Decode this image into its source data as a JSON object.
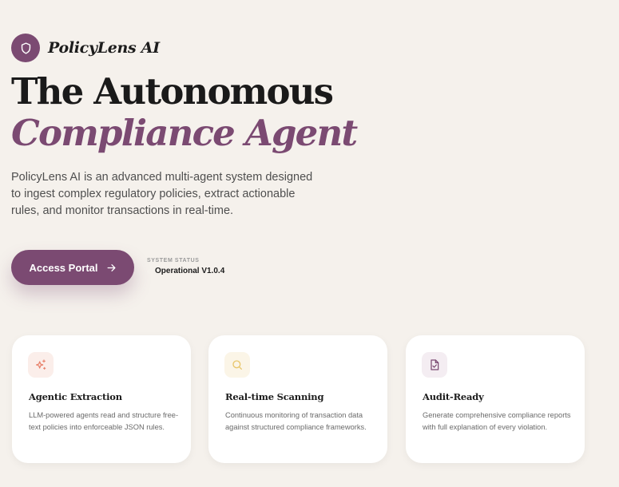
{
  "brand": {
    "name": "PolicyLens AI",
    "icon": "shield-icon",
    "color": "#7b4a72"
  },
  "hero": {
    "title_line1": "The Autonomous",
    "title_line2": "Compliance Agent",
    "description": "PolicyLens AI is an advanced multi-agent system designed to ingest complex regulatory policies, extract actionable rules, and monitor transactions in real-time."
  },
  "cta": {
    "label": "Access Portal",
    "icon": "arrow-right-icon"
  },
  "status": {
    "label": "SYSTEM STATUS",
    "value": "Operational V1.0.4"
  },
  "features": [
    {
      "icon": "sparkles-icon",
      "icon_color": "#e8826b",
      "title": "Agentic Extraction",
      "description": "LLM-powered agents read and structure free-text policies into enforceable JSON rules."
    },
    {
      "icon": "search-icon",
      "icon_color": "#e8c66b",
      "title": "Real-time Scanning",
      "description": "Continuous monitoring of transaction data against structured compliance frameworks."
    },
    {
      "icon": "file-check-icon",
      "icon_color": "#7b4a72",
      "title": "Audit-Ready",
      "description": "Generate comprehensive compliance reports with full explanation of every violation."
    }
  ]
}
